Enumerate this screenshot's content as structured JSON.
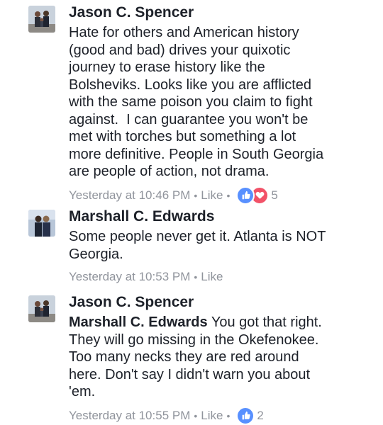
{
  "comments": [
    {
      "author": "Jason C. Spencer",
      "mention": "",
      "text": "Hate for others and American history\n(good and bad) drives your quixotic\njourney to erase history like the\nBolsheviks. Looks like you are afflicted\nwith the same poison you claim to fight\nagainst.  I can guarantee you won't be\nmet with torches but something a lot\nmore definitive. People in South Georgia\nare people of action, not drama.",
      "timestamp": "Yesterday at 10:46 PM",
      "like_label": "Like",
      "reaction_count": "5"
    },
    {
      "author": "Marshall C. Edwards",
      "mention": "",
      "text": "Some people never get it. Atlanta is NOT\nGeorgia.",
      "timestamp": "Yesterday at 10:53 PM",
      "like_label": "Like"
    },
    {
      "author": "Jason C. Spencer",
      "mention": "Marshall C. Edwards",
      "text": " You got that right.\nThey will go missing in the Okefenokee.\nToo many necks they are red around\nhere. Don't say I didn't warn you about\n'em.",
      "timestamp": "Yesterday at 10:55 PM",
      "like_label": "Like",
      "reaction_count": "2"
    }
  ],
  "colors": {
    "text": "#1d2129",
    "meta": "#90949c",
    "like_reaction": "#5890ff",
    "love_reaction": "#f25268"
  },
  "icons": {
    "like": "thumbs-up-icon",
    "love": "heart-icon"
  }
}
